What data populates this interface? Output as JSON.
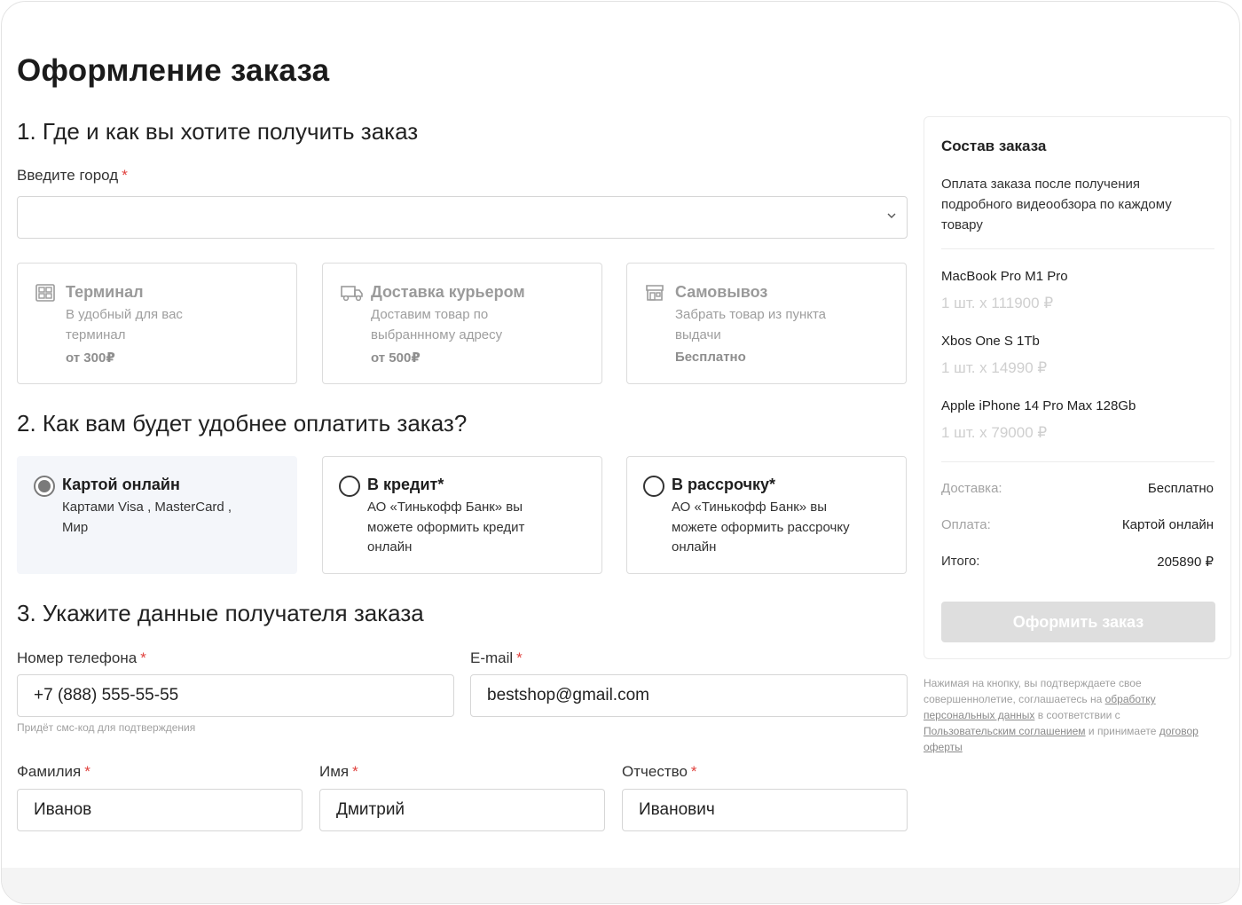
{
  "page": {
    "title": "Оформление заказа"
  },
  "section1": {
    "title": "1. Где и как вы хотите получить заказ",
    "city_label": "Введите город",
    "required_mark": "*",
    "city_value": "",
    "options": [
      {
        "icon": "terminal-icon",
        "title": "Терминал",
        "desc": "В удобный для вас терминал",
        "price": "от 300₽"
      },
      {
        "icon": "truck-icon",
        "title": "Доставка курьером",
        "desc": "Доставим товар по выбраннному адресу",
        "price": "от 500₽"
      },
      {
        "icon": "store-icon",
        "title": "Самовывоз",
        "desc": "Забрать товар из пункта выдачи",
        "price": "Бесплатно"
      }
    ]
  },
  "section2": {
    "title": "2. Как вам будет удобнее оплатить заказ?",
    "options": [
      {
        "title": "Картой онлайн",
        "desc": "Картами Visa , MasterCard , Мир",
        "selected": true
      },
      {
        "title": "В кредит*",
        "desc": "АО «Тинькофф Банк» вы можете оформить кредит онлайн",
        "selected": false
      },
      {
        "title": "В рассрочку*",
        "desc": "АО «Тинькофф Банк» вы можете оформить рассрочку онлайн",
        "selected": false
      }
    ]
  },
  "section3": {
    "title": "3. Укажите данные получателя заказа",
    "required_mark": "*",
    "phone": {
      "label": "Номер телефона",
      "value": "+7 (888) 555-55-55",
      "hint": "Придёт смс-код для подтверждения"
    },
    "email": {
      "label": "E-mail",
      "value": "bestshop@gmail.com"
    },
    "surname": {
      "label": "Фамилия",
      "value": "Иванов"
    },
    "name": {
      "label": "Имя",
      "value": "Дмитрий"
    },
    "patronymic": {
      "label": "Отчество",
      "value": "Иванович"
    }
  },
  "summary": {
    "title": "Состав заказа",
    "note": "Оплата заказа после получения подробного видеообзора по каждому товару",
    "items": [
      {
        "name": "MacBook Pro M1 Pro",
        "qty": "1 шт. x 111900 ₽"
      },
      {
        "name": "Xbos One S 1Tb",
        "qty": "1 шт. x 14990 ₽"
      },
      {
        "name": "Apple iPhone 14 Pro Max 128Gb",
        "qty": "1 шт. x 79000 ₽"
      }
    ],
    "delivery_label": "Доставка:",
    "delivery_value": "Бесплатно",
    "payment_label": "Оплата:",
    "payment_value": "Картой онлайн",
    "total_label": "Итого:",
    "total_value": "205890 ₽",
    "button": "Оформить заказ"
  },
  "legal": {
    "part1": "Нажимая на кнопку, вы подтверждаете свое совершеннолетие, соглашаетесь на",
    "link1": "обработку персональных данных",
    "part2": "в соответствии с",
    "link2": "Пользовательским соглашением",
    "part3": "и принимаете",
    "link3": "договор оферты"
  }
}
